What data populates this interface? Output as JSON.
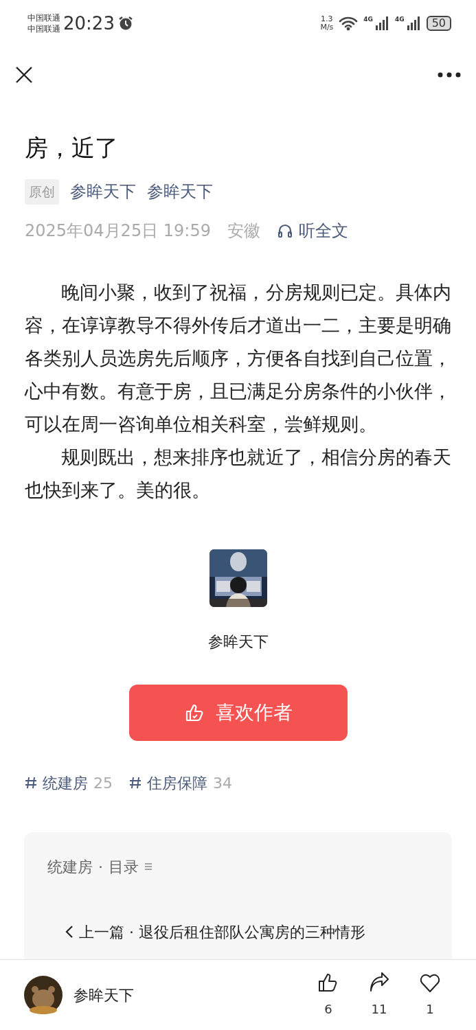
{
  "status_bar": {
    "carriers": [
      "中国联通",
      "中国联通"
    ],
    "time": "20:23",
    "speed_value": "1.3",
    "speed_unit": "M/s",
    "networks": [
      "4G",
      "4G"
    ],
    "battery": "50"
  },
  "article": {
    "title": "房，近了",
    "badge": "原创",
    "authors": [
      "参眸天下",
      "参眸天下"
    ],
    "date": "2025年04月25日 19:59",
    "location": "安徽",
    "listen": "听全文",
    "paragraphs": [
      "晚间小聚，收到了祝福，分房规则已定。具体内容，在谆谆教导不得外传后才道出一二，主要是明确各类别人员选房先后顺序，方便各自找到自己位置，心中有数。有意于房，且已满足分房条件的小伙伴，可以在周一咨询单位相关科室，尝鲜规则。",
      "规则既出，想来排序也就近了，相信分房的春天也快到来了。美的很。"
    ]
  },
  "author_card": {
    "name": "参眸天下",
    "button": "喜欢作者"
  },
  "tags": [
    {
      "name": "统建房",
      "count": "25"
    },
    {
      "name": "住房保障",
      "count": "34"
    }
  ],
  "collection": {
    "name": "统建房",
    "separator": "·",
    "label": "目录",
    "prev_label": "上一篇",
    "prev_separator": "·",
    "prev_title": "退役后租住部队公寓房的三种情形"
  },
  "bottom_bar": {
    "author": "参眸天下",
    "actions": [
      {
        "kind": "like",
        "count": "6"
      },
      {
        "kind": "share",
        "count": "11"
      },
      {
        "kind": "favorite",
        "count": "1"
      }
    ]
  }
}
